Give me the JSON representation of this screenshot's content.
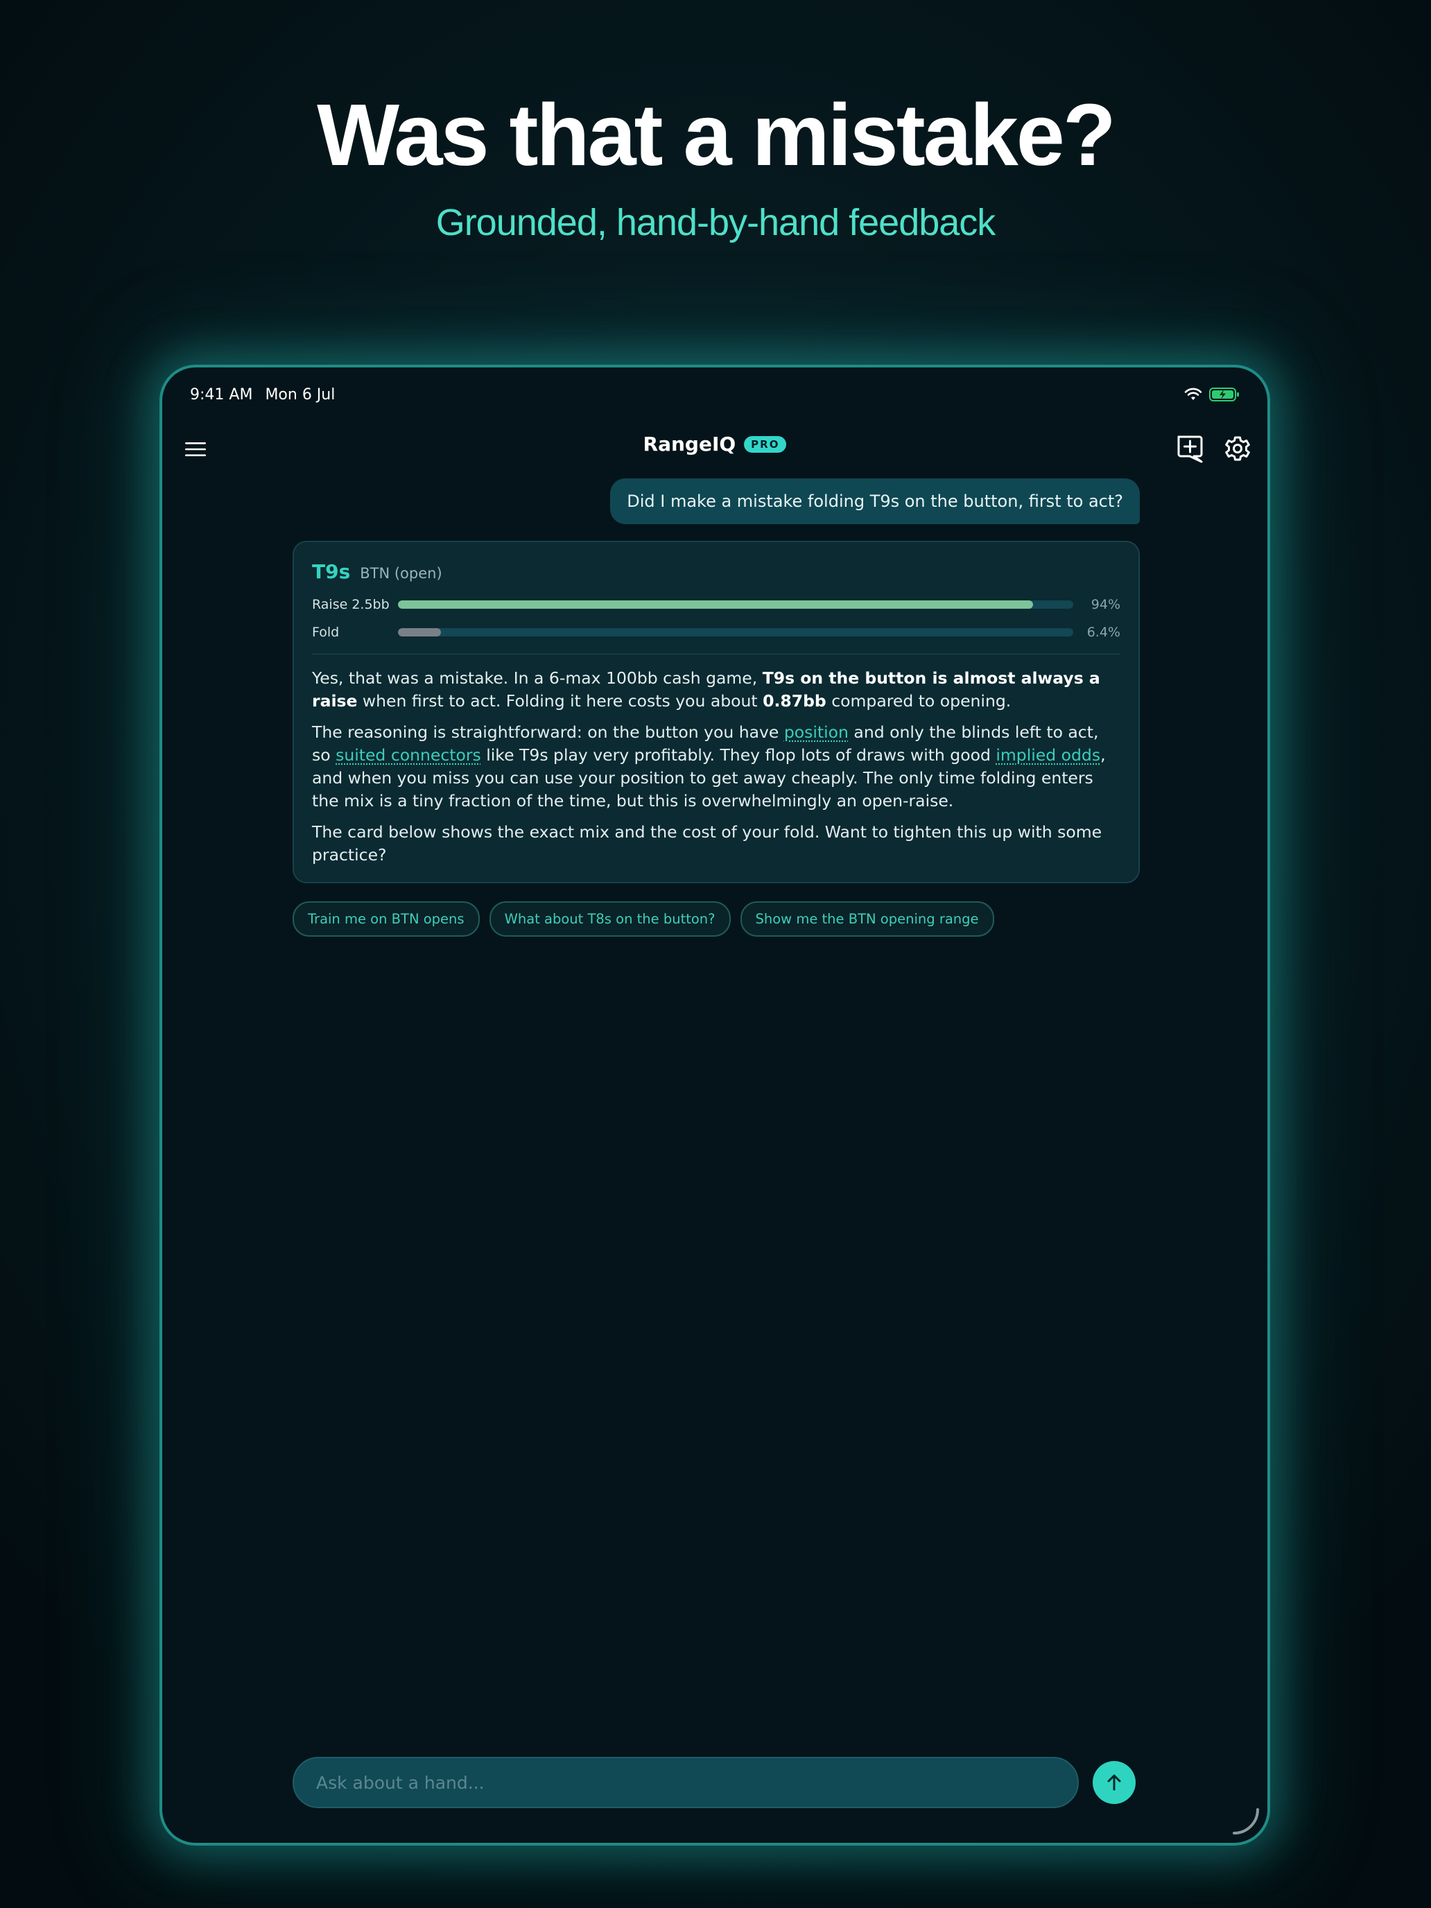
{
  "marketing": {
    "headline": "Was that a mistake?",
    "subheadline": "Grounded, hand-by-hand feedback"
  },
  "status_bar": {
    "time": "9:41 AM",
    "date": "Mon 6 Jul"
  },
  "nav": {
    "title": "RangeIQ",
    "badge": "PRO",
    "icons": [
      "menu-icon",
      "new-chat-icon",
      "settings-icon"
    ]
  },
  "chat": {
    "user_message": "Did I make a mistake folding T9s on the button, first to act?",
    "card": {
      "hand": "T9s",
      "position": "BTN (open)",
      "mix": [
        {
          "label": "Raise 2.5bb",
          "pct_text": "94%",
          "fraction": 0.94,
          "color": "#7dc49a"
        },
        {
          "label": "Fold",
          "pct_text": "6.4%",
          "fraction": 0.064,
          "color": "#7a8088"
        }
      ],
      "p1_a": "Yes, that was a mistake. In a 6-max 100bb cash game, ",
      "p1_b": "T9s on the button is almost always a raise",
      "p1_c": " when first to act. Folding it here costs you about ",
      "p1_d": "0.87bb",
      "p1_e": " compared to opening.",
      "p2_a": "The reasoning is straightforward: on the button you have ",
      "p2_link1": "position",
      "p2_b": " and only the blinds left to act, so ",
      "p2_link2": "suited connectors",
      "p2_c": " like T9s play very profitably. They flop lots of draws with good ",
      "p2_link3": "implied odds",
      "p2_d": ", and when you miss you can use your position to get away cheaply. The only time folding enters the mix is a tiny fraction of the time, but this is overwhelmingly an open-raise.",
      "p3": "The card below shows the exact mix and the cost of your fold. Want to tighten this up with some practice?"
    },
    "suggestions": [
      "Train me on BTN opens",
      "What about T8s on the button?",
      "Show me the BTN opening range"
    ]
  },
  "composer": {
    "placeholder": "Ask about a hand...",
    "value": ""
  },
  "colors": {
    "accent": "#2fd4c0",
    "raise_bar": "#7dc49a",
    "fold_bar": "#7a8088",
    "headline_sub": "#4fe0c8"
  }
}
